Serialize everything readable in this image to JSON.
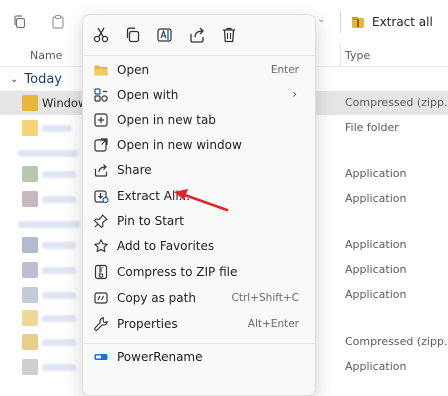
{
  "toolbar": {
    "extract_all_label": "Extract all",
    "icons": [
      "copy-icon",
      "paste-icon",
      "chevron-down-icon",
      "extract-all-icon"
    ]
  },
  "columns": {
    "name": "Name",
    "type": "Type"
  },
  "group": {
    "label": "Today"
  },
  "files": [
    {
      "name": "WindowsF",
      "type": "Compressed (zipp...",
      "selected": true
    },
    {
      "name": "",
      "type": "File folder"
    },
    {
      "name": "",
      "type": ""
    },
    {
      "name": "",
      "type": "Application"
    },
    {
      "name": "",
      "type": "Application"
    },
    {
      "name": "",
      "type": ""
    },
    {
      "name": "",
      "type": "Application"
    },
    {
      "name": "",
      "type": "Application"
    },
    {
      "name": "",
      "type": "Application"
    },
    {
      "name": "",
      "type": ""
    },
    {
      "name": "",
      "type": "Compressed (zipp..."
    },
    {
      "name": "",
      "type": "Application"
    }
  ],
  "context_menu": {
    "quick_actions": [
      "cut-icon",
      "copy-icon",
      "rename-icon",
      "share-icon",
      "delete-icon"
    ],
    "items": [
      {
        "label": "Open",
        "shortcut": "Enter",
        "icon": "folder-open-icon"
      },
      {
        "label": "Open with",
        "shortcut": "",
        "icon": "open-with-icon",
        "submenu": "›"
      },
      {
        "label": "Open in new tab",
        "shortcut": "",
        "icon": "new-tab-icon"
      },
      {
        "label": "Open in new window",
        "shortcut": "",
        "icon": "new-window-icon"
      },
      {
        "label": "Share",
        "shortcut": "",
        "icon": "share-icon"
      },
      {
        "label": "Extract All...",
        "shortcut": "",
        "icon": "extract-all-icon"
      },
      {
        "label": "Pin to Start",
        "shortcut": "",
        "icon": "pin-icon"
      },
      {
        "label": "Add to Favorites",
        "shortcut": "",
        "icon": "star-icon"
      },
      {
        "label": "Compress to ZIP file",
        "shortcut": "",
        "icon": "zip-icon"
      },
      {
        "label": "Copy as path",
        "shortcut": "Ctrl+Shift+C",
        "icon": "copy-path-icon"
      },
      {
        "label": "Properties",
        "shortcut": "Alt+Enter",
        "icon": "wrench-icon"
      },
      {
        "label": "PowerRename",
        "shortcut": "",
        "icon": "power-rename-icon"
      }
    ]
  },
  "colors": {
    "accent": "#0a5fb4",
    "annotation_arrow": "#e0262b",
    "zip_folder": "#e8b73a",
    "selection": "#e5e5e5"
  }
}
